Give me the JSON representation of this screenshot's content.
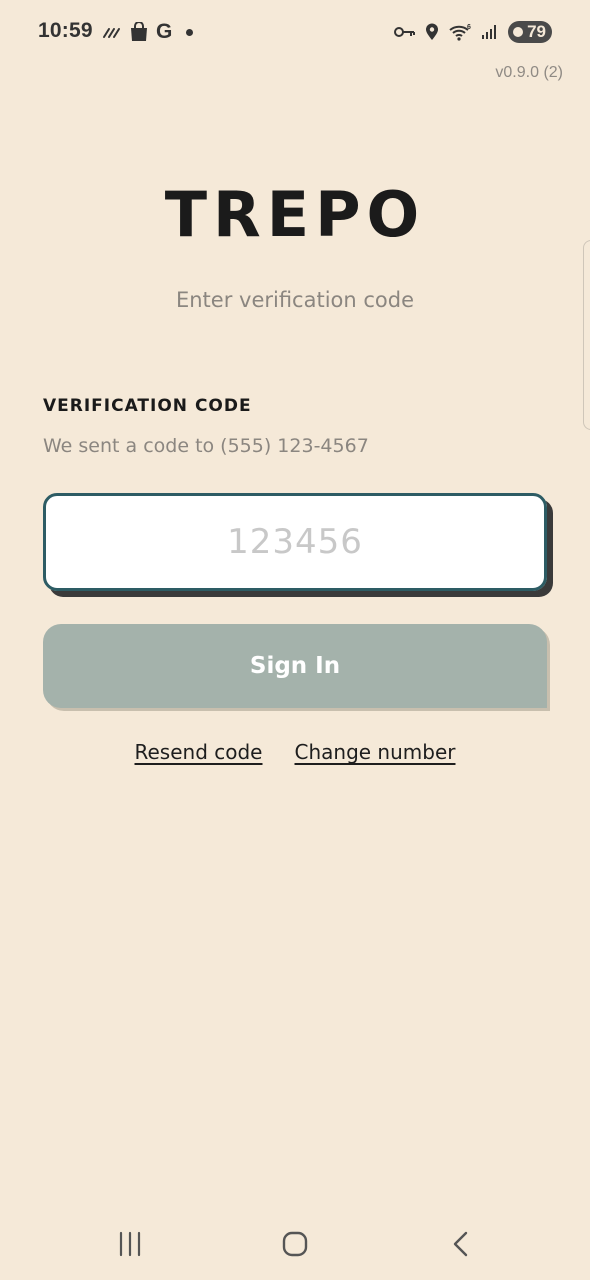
{
  "status_bar": {
    "time": "10:59",
    "carrier_letter": "G",
    "battery_level": "79",
    "icons_left": [
      "stripes-icon",
      "shopping-bag-icon",
      "google-icon",
      "notification-dot-icon"
    ],
    "icons_right": [
      "vpn-key-icon",
      "location-icon",
      "wifi-icon",
      "signal-icon",
      "battery-icon"
    ]
  },
  "app": {
    "version": "v0.9.0 (2)",
    "logo": "TREPO",
    "subtitle": "Enter verification code"
  },
  "form": {
    "label": "VERIFICATION CODE",
    "hint": "We sent a code to (555) 123-4567",
    "code_value": "",
    "code_placeholder": "123456",
    "submit_label": "Sign In"
  },
  "links": {
    "resend": "Resend code",
    "change": "Change number"
  },
  "nav": {
    "icons": [
      "recent-apps-icon",
      "home-icon",
      "back-icon"
    ]
  },
  "colors": {
    "background": "#f5e9d8",
    "input_border": "#2d5c64",
    "button_disabled": "#a4b2ab"
  }
}
